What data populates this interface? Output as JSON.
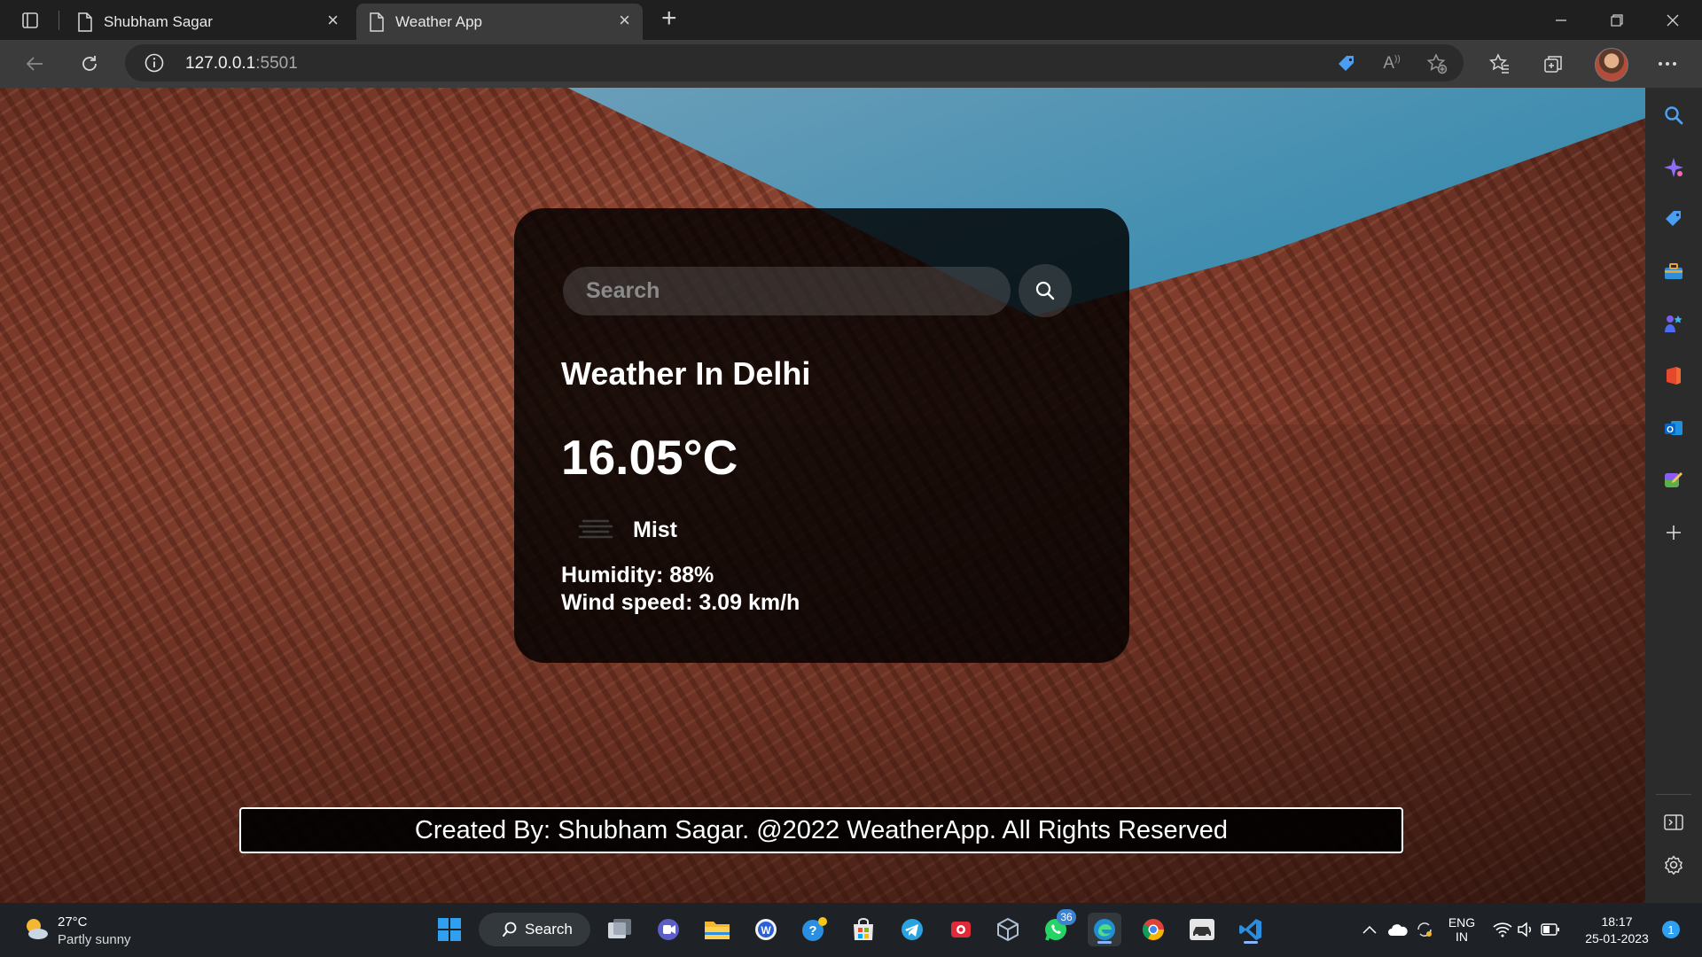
{
  "browser": {
    "tabs": [
      {
        "title": "Shubham Sagar",
        "active": false
      },
      {
        "title": "Weather App",
        "active": true
      }
    ],
    "new_tab_label": "+",
    "url_host": "127.0.0.1",
    "url_port": ":5501"
  },
  "app": {
    "search_placeholder": "Search",
    "city_heading": "Weather In Delhi",
    "temperature": "16.05°C",
    "description": "Mist",
    "humidity": "Humidity: 88%",
    "wind": "Wind speed: 3.09 km/h",
    "footer": "Created By: Shubham Sagar. @2022 WeatherApp. All Rights Reserved"
  },
  "taskbar": {
    "weather_temp": "27°C",
    "weather_condition": "Partly sunny",
    "search_label": "Search",
    "whatsapp_badge": "36",
    "language": "ENG",
    "region": "IN",
    "time": "18:17",
    "date": "25-01-2023",
    "notification_count": "1"
  },
  "icons": {
    "sidebar": [
      "search-icon",
      "copilot-icon",
      "shopping-tag-icon",
      "tools-icon",
      "games-icon",
      "office-icon",
      "outlook-icon",
      "designer-icon",
      "add-icon",
      "split-screen-icon",
      "settings-icon"
    ],
    "apps": [
      "start-icon",
      "task-view-icon",
      "teams-icon",
      "file-explorer-icon",
      "word-icon",
      "help-icon",
      "store-icon",
      "telegram-icon",
      "screen-recorder-icon",
      "virtualbox-icon",
      "whatsapp-icon",
      "edge-icon",
      "chrome-icon",
      "vehicle-app-icon",
      "vscode-icon"
    ]
  },
  "colors": {
    "accent": "#3b82d1",
    "card_bg": "#000000",
    "sky": "#3f8db0",
    "stone": "#8a4532"
  }
}
